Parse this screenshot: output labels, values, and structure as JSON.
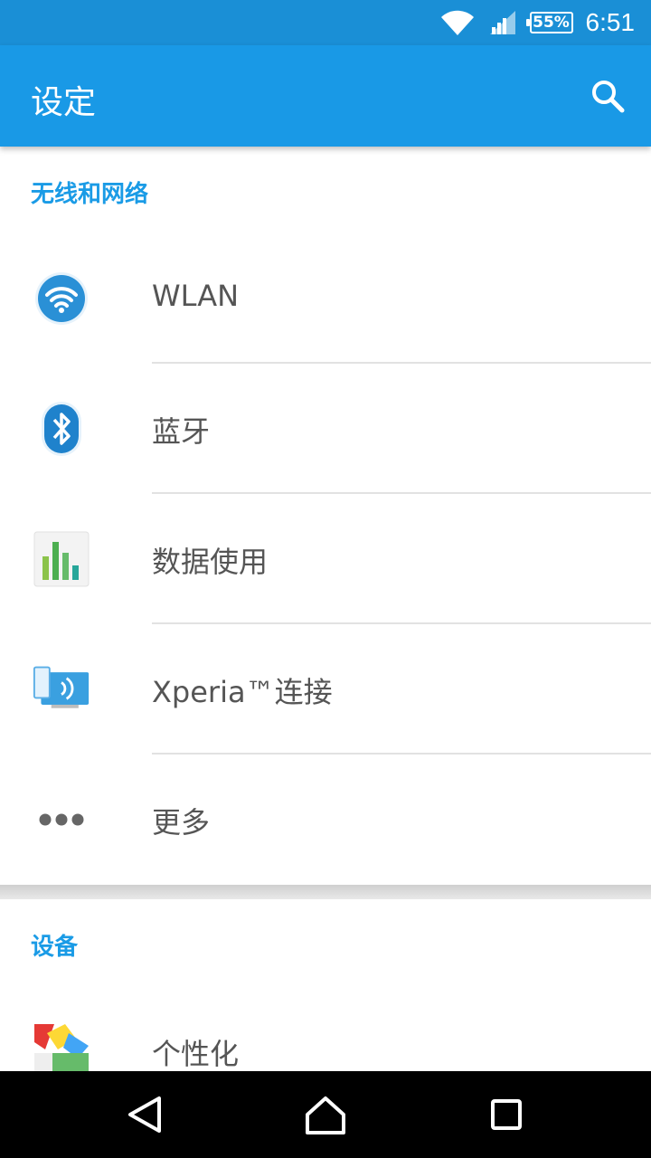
{
  "status_bar": {
    "battery": "55%",
    "time": "6:51",
    "icons": [
      "wifi-icon",
      "cell-signal-icon",
      "battery-icon"
    ]
  },
  "app_bar": {
    "title": "设定",
    "search_icon": "search-icon",
    "color": "#1999e6"
  },
  "sections": [
    {
      "header": "无线和网络",
      "items": [
        {
          "label": "WLAN",
          "icon": "wifi-settings-icon"
        },
        {
          "label": "蓝牙",
          "icon": "bluetooth-icon"
        },
        {
          "label": "数据使用",
          "icon": "data-usage-icon"
        },
        {
          "label": "Xperia™连接",
          "icon": "xperia-connectivity-icon"
        },
        {
          "label": "更多",
          "icon": "more-dots-icon"
        }
      ]
    },
    {
      "header": "设备",
      "items": [
        {
          "label": "个性化",
          "icon": "personalization-icon"
        }
      ]
    }
  ],
  "nav_bar": {
    "icons": [
      "back-icon",
      "home-icon",
      "recents-icon"
    ]
  },
  "colors": {
    "accent": "#1a9be6",
    "status_bar": "#1a8fd6"
  }
}
